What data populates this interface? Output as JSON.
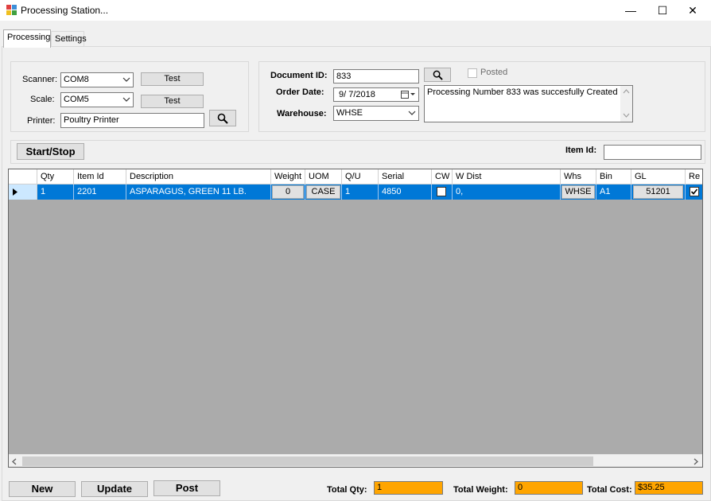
{
  "window": {
    "title": "Processing Station...",
    "minimize": "—",
    "maximize": "☐",
    "close": "✕"
  },
  "tabs": [
    "Processing",
    "Settings"
  ],
  "devices": {
    "scanner_label": "Scanner:",
    "scanner_value": "COM8",
    "scale_label": "Scale:",
    "scale_value": "COM5",
    "printer_label": "Printer:",
    "printer_value": "Poultry Printer",
    "test_label": "Test"
  },
  "document": {
    "docid_label": "Document ID:",
    "docid_value": "833",
    "posted_label": "Posted",
    "orderdate_label": "Order Date:",
    "orderdate_value": "9/  7/2018",
    "warehouse_label": "Warehouse:",
    "warehouse_value": "WHSE",
    "message": "Processing Number 833 was succesfully Created"
  },
  "toolbar": {
    "startstop_label": "Start/Stop",
    "itemid_label": "Item Id:",
    "itemid_value": ""
  },
  "grid": {
    "columns": [
      "Qty",
      "Item Id",
      "Description",
      "Weight",
      "UOM",
      "Q/U",
      "Serial",
      "CW",
      "W Dist",
      "Whs",
      "Bin",
      "GL",
      "Re"
    ],
    "rows": [
      {
        "qty": "1",
        "item_id": "2201",
        "description": "ASPARAGUS, GREEN 11 LB.",
        "weight": "0",
        "uom": "CASE",
        "qu": "1",
        "serial": "4850",
        "cw": false,
        "wdist": "0,",
        "whs": "WHSE",
        "bin": "A1",
        "gl": "51201",
        "re": true
      }
    ]
  },
  "actions": {
    "new_label": "New",
    "update_label": "Update",
    "post_label": "Post"
  },
  "totals": {
    "qty_label": "Total Qty:",
    "qty_value": "1",
    "weight_label": "Total  Weight:",
    "weight_value": "0",
    "cost_label": "Total Cost:",
    "cost_value": "$35.25"
  },
  "colors": {
    "selection": "#0078d7",
    "total_highlight": "#ffa500"
  }
}
